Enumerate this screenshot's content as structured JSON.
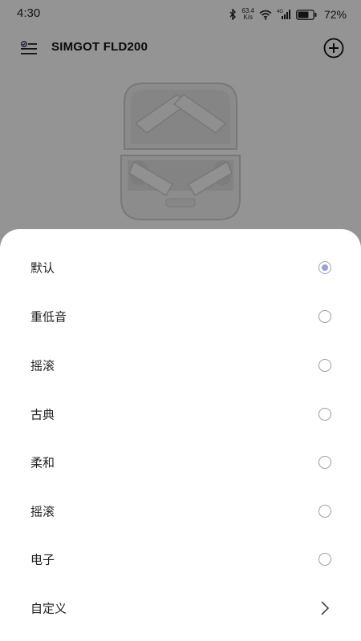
{
  "status_bar": {
    "time": "4:30",
    "net_speed_value": "63.4",
    "net_speed_unit": "K/s",
    "network_type": "4G",
    "battery_percent": "72%",
    "icons": [
      "bluetooth-icon",
      "wifi-icon",
      "signal-icon",
      "battery-icon"
    ]
  },
  "header": {
    "title": "SIMGOT FLD200",
    "menu_icon": "list-menu-icon",
    "add_icon": "add-circle-icon"
  },
  "device": {
    "image": "earbuds-charging-case"
  },
  "eq_sheet": {
    "options": [
      {
        "label": "默认",
        "selected": true
      },
      {
        "label": "重低音",
        "selected": false
      },
      {
        "label": "摇滚",
        "selected": false
      },
      {
        "label": "古典",
        "selected": false
      },
      {
        "label": "柔和",
        "selected": false
      },
      {
        "label": "摇滚",
        "selected": false
      },
      {
        "label": "电子",
        "selected": false
      }
    ],
    "custom": {
      "label": "自定义",
      "icon": "chevron-right-icon"
    }
  },
  "colors": {
    "accent": "#9aa0d8",
    "scrim": "rgba(0,0,0,0.42)",
    "text": "#222222"
  }
}
